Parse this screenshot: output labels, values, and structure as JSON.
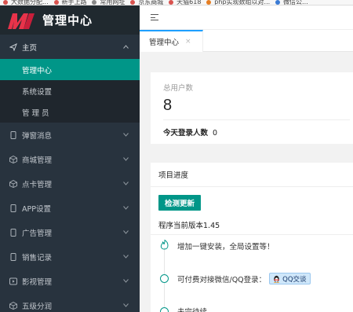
{
  "browser": {
    "bookmarks": [
      "大数据分配...",
      "新手上路",
      "常用网址",
      "京东商城",
      "天猫618",
      "php实现数组以对...",
      "微信公..."
    ]
  },
  "sidebar": {
    "logo_text": "管理中心",
    "groups": [
      {
        "label": "主页",
        "icon": "paper-plane-icon",
        "open": true,
        "children": [
          {
            "label": "管理中心",
            "active": true
          },
          {
            "label": "系统设置",
            "active": false
          },
          {
            "label": "管 理 员",
            "active": false
          }
        ]
      },
      {
        "label": "弹窗消息",
        "icon": "phone-icon"
      },
      {
        "label": "商城管理",
        "icon": "cube-icon"
      },
      {
        "label": "点卡管理",
        "icon": "cube-icon"
      },
      {
        "label": "APP设置",
        "icon": "phone-icon"
      },
      {
        "label": "广告管理",
        "icon": "phone-icon"
      },
      {
        "label": "销售记录",
        "icon": "phone-icon"
      },
      {
        "label": "影视管理",
        "icon": "play-icon"
      },
      {
        "label": "五级分润",
        "icon": "cube-icon"
      }
    ]
  },
  "tabs": [
    {
      "label": "管理中心",
      "close": "×"
    }
  ],
  "stats": {
    "total_users_label": "总用户数",
    "total_users_value": "8",
    "today_login_label": "今天登录人数",
    "today_login_value": "0"
  },
  "progress": {
    "title": "项目进度",
    "check_button": "检测更新",
    "version_text": "程序当前版本1.45",
    "timeline": [
      {
        "text": "增加一键安装，全局设置等！",
        "marker": "flame"
      },
      {
        "text": "可付费对接微信/QQ登录：",
        "marker": "dot",
        "badge": "QQ交谈"
      },
      {
        "text": "未完待续……",
        "marker": "dot"
      }
    ]
  },
  "colors": {
    "sidebar_bg": "#28333e",
    "accent": "#009688",
    "tab_accent": "#1e9fff"
  }
}
